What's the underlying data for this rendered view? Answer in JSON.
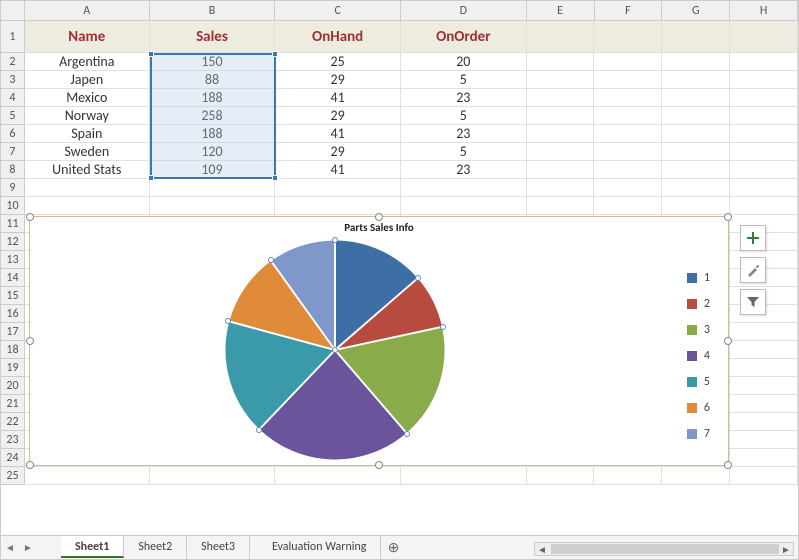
{
  "grid": {
    "cols": [
      "A",
      "B",
      "C",
      "D",
      "E",
      "F",
      "G",
      "H"
    ],
    "header_row": [
      "Name",
      "Sales",
      "OnHand",
      "OnOrder"
    ],
    "rows": [
      {
        "n": "2",
        "name": "Argentina",
        "sales": 150,
        "onhand": 25,
        "onorder": 20
      },
      {
        "n": "3",
        "name": "Japen",
        "sales": 88,
        "onhand": 29,
        "onorder": 5
      },
      {
        "n": "4",
        "name": "Mexico",
        "sales": 188,
        "onhand": 41,
        "onorder": 23
      },
      {
        "n": "5",
        "name": "Norway",
        "sales": 258,
        "onhand": 29,
        "onorder": 5
      },
      {
        "n": "6",
        "name": "Spain",
        "sales": 188,
        "onhand": 41,
        "onorder": 23
      },
      {
        "n": "7",
        "name": "Sweden",
        "sales": 120,
        "onhand": 29,
        "onorder": 5
      },
      {
        "n": "8",
        "name": "United Stats",
        "sales": 109,
        "onhand": 41,
        "onorder": 23
      }
    ],
    "blank_rows": [
      "9",
      "10",
      "11",
      "12",
      "13",
      "14",
      "15",
      "16",
      "17",
      "18",
      "19",
      "20",
      "21",
      "22",
      "23",
      "24",
      "25"
    ]
  },
  "selection": {
    "range": "B2:B8"
  },
  "chart_data": {
    "type": "pie",
    "title": "Parts Sales Info",
    "categories": [
      "1",
      "2",
      "3",
      "4",
      "5",
      "6",
      "7"
    ],
    "values": [
      150,
      88,
      188,
      258,
      188,
      120,
      109
    ],
    "series_colors": [
      "#3d6ea5",
      "#b84b3f",
      "#8aab4a",
      "#6a549c",
      "#3b9aa9",
      "#e08b3a",
      "#7f98c9"
    ]
  },
  "tabs": [
    "Sheet1",
    "Sheet2",
    "Sheet3",
    "Evaluation Warning"
  ]
}
